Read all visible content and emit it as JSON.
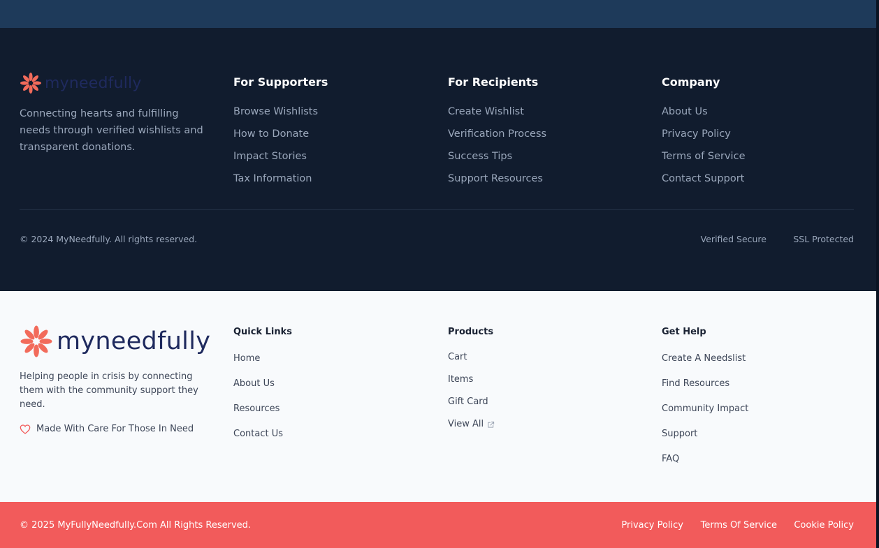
{
  "top_strip": {},
  "dark_footer": {
    "brand": {
      "logo_text": "myneedfully",
      "description": "Connecting hearts and fulfilling needs through verified wishlists and transparent donations."
    },
    "columns": [
      {
        "heading": "For Supporters",
        "links": [
          "Browse Wishlists",
          "How to Donate",
          "Impact Stories",
          "Tax Information"
        ]
      },
      {
        "heading": "For Recipients",
        "links": [
          "Create Wishlist",
          "Verification Process",
          "Success Tips",
          "Support Resources"
        ]
      },
      {
        "heading": "Company",
        "links": [
          "About Us",
          "Privacy Policy",
          "Terms of Service",
          "Contact Support"
        ]
      }
    ],
    "copyright": "© 2024 MyNeedfully. All rights reserved.",
    "badges": [
      "Verified Secure",
      "SSL Protected"
    ]
  },
  "light_footer": {
    "brand": {
      "logo_text": "myneedfully",
      "description": "Helping people in crisis by connecting them with the community support they need.",
      "care_text": "Made With Care For Those In Need"
    },
    "columns": [
      {
        "heading": "Quick Links",
        "links": [
          "Home",
          "About Us",
          "Resources",
          "Contact Us"
        ]
      },
      {
        "heading": "Products",
        "links": [
          "Cart",
          "Items",
          "Gift Card",
          "View All"
        ]
      },
      {
        "heading": "Get Help",
        "links": [
          "Create A Needslist",
          "Find Resources",
          "Community Impact",
          "Support",
          "FAQ"
        ]
      }
    ]
  },
  "bottom_bar": {
    "copyright": "© 2025 MyFullyNeedfully.Com All Rights Reserved.",
    "links": [
      "Privacy Policy",
      "Terms Of Service",
      "Cookie Policy"
    ]
  },
  "colors": {
    "brand_coral": "#f25b5b",
    "navy_dark": "#111c2e",
    "logo_navy": "#1f2a5e"
  }
}
